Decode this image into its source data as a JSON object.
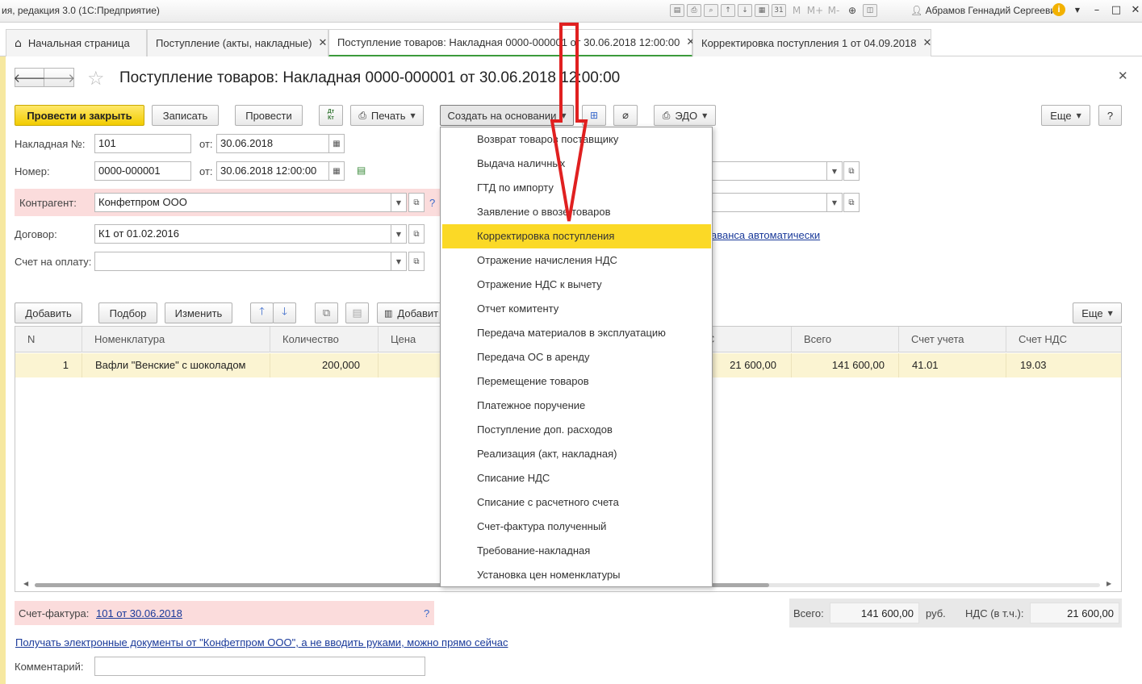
{
  "titlebar": {
    "app_title": "ия, редакция 3.0  (1С:Предприятие)",
    "icons": [
      "save-icon",
      "print-icon",
      "preview-icon",
      "upload-icon",
      "download-icon",
      "calculator-icon",
      "calendar-icon"
    ],
    "calendar_day": "31",
    "mem": [
      "M",
      "M+",
      "M-"
    ],
    "user": "Абрамов Геннадий Сергеевич",
    "info": "i",
    "minimize": "–",
    "maximize": "□",
    "close": "✕"
  },
  "tabs": [
    {
      "label": "Начальная страница",
      "closable": false,
      "active": false
    },
    {
      "label": "Поступление (акты, накладные)",
      "closable": true,
      "active": false
    },
    {
      "label": "Поступление товаров: Накладная 0000-000001 от 30.06.2018 12:00:00",
      "closable": true,
      "active": true
    },
    {
      "label": "Корректировка поступления 1 от 04.09.2018",
      "closable": true,
      "active": false
    }
  ],
  "header": {
    "title": "Поступление товаров: Накладная 0000-000001 от 30.06.2018 12:00:00"
  },
  "toolbar": {
    "post_close": "Провести и закрыть",
    "save": "Записать",
    "post": "Провести",
    "dtkt": "Дт Кт",
    "print": "Печать",
    "create_based": "Создать на основании",
    "edo": "ЭДО",
    "more": "Еще",
    "help": "?"
  },
  "form": {
    "invoice_no_label": "Накладная №:",
    "invoice_no": "101",
    "from_label": "от:",
    "invoice_date": "30.06.2018",
    "number_label": "Номер:",
    "number": "0000-000001",
    "number_date": "30.06.2018 12:00:00",
    "counterparty_label": "Контрагент:",
    "counterparty": "Конфетпром ООО",
    "contract_label": "Договор:",
    "contract": "К1 от 01.02.2016",
    "payment_account_label": "Счет на оплату:",
    "payment_account": "",
    "advance_link": "аванса автоматически",
    "q": "?"
  },
  "table_toolbar": {
    "add": "Добавить",
    "pick": "Подбор",
    "change": "Изменить",
    "add2": "Добавит",
    "more": "Еще"
  },
  "table": {
    "columns": [
      "N",
      "Номенклатура",
      "Количество",
      "Цена",
      "С",
      "Всего",
      "Счет учета",
      "Счет НДС"
    ],
    "rows": [
      {
        "n": "1",
        "item": "Вафли \"Венские\" с шоколадом",
        "qty": "200,000",
        "price": "",
        "vat": "21 600,00",
        "total": "141 600,00",
        "account": "41.01",
        "vat_account": "19.03"
      }
    ]
  },
  "dropdown": {
    "items": [
      "Возврат товаров поставщику",
      "Выдача наличных",
      "ГТД по импорту",
      "Заявление о ввозе товаров",
      "Корректировка поступления",
      "Отражение начисления НДС",
      "Отражение НДС к вычету",
      "Отчет комитенту",
      "Передача материалов в эксплуатацию",
      "Передача ОС в аренду",
      "Перемещение товаров",
      "Платежное поручение",
      "Поступление доп. расходов",
      "Реализация (акт, накладная)",
      "Списание НДС",
      "Списание с расчетного счета",
      "Счет-фактура полученный",
      "Требование-накладная",
      "Установка цен номенклатуры"
    ],
    "highlighted_index": 4
  },
  "footer": {
    "invoice_label": "Счет-фактура:",
    "invoice_link": "101 от 30.06.2018",
    "q": "?",
    "edo_link": "Получать электронные документы от \"Конфетпром ООО\", а не вводить руками, можно прямо сейчас",
    "comment_label": "Комментарий:",
    "comment": "",
    "total_label": "Всего:",
    "total": "141 600,00",
    "currency": "руб.",
    "vat_label": "НДС (в т.ч.):",
    "vat": "21 600,00"
  },
  "colors": {
    "primary_button": "#f2cc00",
    "highlight": "#fbd926",
    "required_field_bg": "#fbdcdc",
    "link": "#1a3a9a",
    "annotation_arrow": "#e02020"
  }
}
